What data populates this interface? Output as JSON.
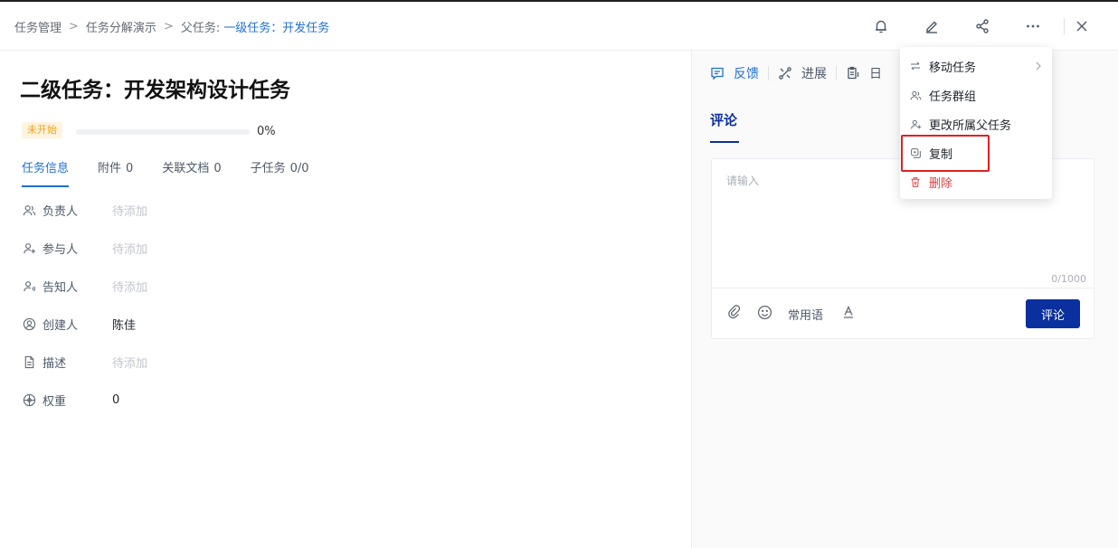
{
  "breadcrumb": {
    "items": [
      "任务管理",
      "任务分解演示"
    ],
    "parent_prefix": "父任务:",
    "parent_current": "一级任务：开发任务",
    "separator": ">"
  },
  "header_icons": [
    "bell-icon",
    "edit-icon",
    "share-icon",
    "more-icon",
    "close-icon"
  ],
  "task": {
    "title": "二级任务：开发架构设计任务",
    "status": "未开始",
    "progress": 0,
    "progress_text": "0%"
  },
  "tabs": [
    {
      "label": "任务信息",
      "count": "",
      "active": true
    },
    {
      "label": "附件",
      "count": "0",
      "active": false
    },
    {
      "label": "关联文档",
      "count": "0",
      "active": false
    },
    {
      "label": "子任务",
      "count": "0/0",
      "active": false
    }
  ],
  "fields": [
    {
      "label": "负责人",
      "value": "待添加",
      "placeholder": true,
      "icon": "owner-icon"
    },
    {
      "label": "参与人",
      "value": "待添加",
      "placeholder": true,
      "icon": "participant-icon"
    },
    {
      "label": "告知人",
      "value": "待添加",
      "placeholder": true,
      "icon": "notify-icon"
    },
    {
      "label": "创建人",
      "value": "陈佳",
      "placeholder": false,
      "icon": "creator-icon"
    },
    {
      "label": "描述",
      "value": "待添加",
      "placeholder": true,
      "icon": "document-icon"
    },
    {
      "label": "权重",
      "value": "0",
      "placeholder": false,
      "icon": "weight-icon"
    }
  ],
  "right_tabs": [
    {
      "label": "反馈",
      "icon": "feedback-icon",
      "active": true
    },
    {
      "label": "进展",
      "icon": "progress-icon",
      "active": false
    },
    {
      "label": "日",
      "icon": "log-icon",
      "active": false
    }
  ],
  "comment": {
    "tab": "评论",
    "placeholder": "请输入",
    "counter": "0/1000",
    "quick_phrases": "常用语",
    "submit": "评论"
  },
  "menu": {
    "items": [
      {
        "label": "移动任务",
        "icon": "move-icon",
        "submenu": true,
        "danger": false
      },
      {
        "label": "任务群组",
        "icon": "group-icon",
        "submenu": false,
        "danger": false
      },
      {
        "label": "更改所属父任务",
        "icon": "change-parent-icon",
        "submenu": false,
        "danger": false
      },
      {
        "label": "复制",
        "icon": "copy-icon",
        "submenu": false,
        "danger": false
      },
      {
        "label": "删除",
        "icon": "delete-icon",
        "submenu": false,
        "danger": true
      }
    ],
    "highlighted": "复制"
  },
  "colors": {
    "accent": "#1f6fd6",
    "primary_button": "#0a2f9e",
    "status_bg": "#fff4de",
    "status_text": "#f0a020",
    "danger": "#e53e3e",
    "highlight_border": "#e02020"
  }
}
